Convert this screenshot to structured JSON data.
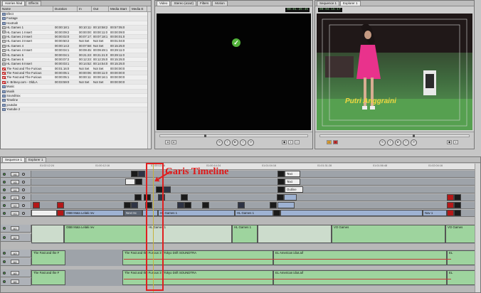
{
  "browser": {
    "tabs": [
      "Harries hlad",
      "Effects"
    ],
    "columns": [
      "Name",
      "Duration",
      "In",
      "Out",
      "Media Start",
      "Media E"
    ],
    "rows": [
      {
        "kind": "folder",
        "name": "Efect"
      },
      {
        "kind": "folder",
        "name": "Footage"
      },
      {
        "kind": "folder",
        "name": "Hootnah"
      },
      {
        "kind": "seq",
        "name": "HL Games 1",
        "duration": "00:00:18:1",
        "in": "00:10:11:0",
        "out": "00:10:58:2",
        "ms": "00:57:05:0"
      },
      {
        "kind": "seq",
        "name": "HL Games 1 Insert",
        "duration": "00:00:09:2",
        "in": "00:00:00:0",
        "out": "00:00:11:0",
        "ms": "00:00:09:0"
      },
      {
        "kind": "seq",
        "name": "HL Games 2 Insert",
        "duration": "00:00:02:0",
        "in": "00:07:17:0",
        "out": "00:07:18:1",
        "ms": "00:00:01:0"
      },
      {
        "kind": "seq",
        "name": "HL Games 3 Insert",
        "duration": "00:00:50:2",
        "in": "Not Set",
        "out": "Not Set",
        "ms": "00:01:04:0"
      },
      {
        "kind": "seq",
        "name": "HL Games 4",
        "duration": "00:00:14:2",
        "in": "00:07:58:1",
        "out": "Not Set",
        "ms": "00:15:25:0"
      },
      {
        "kind": "seq",
        "name": "HL Games 4 Insert",
        "duration": "00:00:04:1",
        "in": "00:09:45:2",
        "out": "00:09:49:1",
        "ms": "00:29:11:0"
      },
      {
        "kind": "seq",
        "name": "HL Games 5",
        "duration": "00:00:04:1",
        "in": "00:21:23:1",
        "out": "00:21:21:0",
        "ms": "00:29:11:0"
      },
      {
        "kind": "seq",
        "name": "HL Games 6",
        "duration": "00:00:07:2",
        "in": "00:12:23:0",
        "out": "00:12:25:0",
        "ms": "00:15:25:0"
      },
      {
        "kind": "seq",
        "name": "HL Games 6 Insert",
        "duration": "00:00:03:1",
        "in": "00:14:52:1",
        "out": "00:14:54:0",
        "ms": "00:15:25:0"
      },
      {
        "kind": "red",
        "name": "The Fast and The Furious",
        "duration": "00:01:16:0",
        "in": "Not Set",
        "out": "Not Set",
        "ms": "00:00:00:0"
      },
      {
        "kind": "red",
        "name": "The Fast and The Furious",
        "duration": "00:00:05:1",
        "in": "00:00:06:2",
        "out": "00:00:11:0",
        "ms": "00:00:00:0"
      },
      {
        "kind": "red",
        "name": "The Fast and The Furious",
        "duration": "00:00:05:1",
        "in": "00:00:11:1",
        "out": "00:00:16:1",
        "ms": "00:00:00:0"
      },
      {
        "kind": "red",
        "name": "X- Britney.com - OldLA",
        "duration": "00:03:59:0",
        "in": "Not Set",
        "out": "Not Set",
        "ms": "00:00:00:0"
      },
      {
        "kind": "folder",
        "name": "Music"
      },
      {
        "kind": "folder",
        "name": "Musik"
      },
      {
        "kind": "folder",
        "name": "Soundtrax"
      },
      {
        "kind": "folder",
        "name": "Timeline"
      },
      {
        "kind": "folder",
        "name": "youtube"
      },
      {
        "kind": "folder",
        "name": "Youtube 2"
      }
    ]
  },
  "viewer": {
    "tabs": [
      "Video",
      "Stereo (a1a2)",
      "Filters",
      "Motion"
    ],
    "timecode": "00:01:26:45"
  },
  "canvas": {
    "tabs": [
      "Sequence 1",
      "Explorer 1"
    ],
    "timecode": "00:04:15:17",
    "overlay_name": "Putri Anggraini"
  },
  "timeline": {
    "tabs": [
      "Sequence 1",
      "Explorer 1"
    ],
    "ruler": [
      "01:02:12:24",
      "01:00:12:16",
      "01:00:13:16",
      "01:00:14:24",
      "01:01:04:16",
      "01:01:31:28",
      "01:01:56:48",
      "01:02:04:16"
    ],
    "video_tracks": [
      {
        "label": "V6"
      },
      {
        "label": "V5"
      },
      {
        "label": "V4"
      },
      {
        "label": "V3"
      },
      {
        "label": "V2"
      },
      {
        "label": "V1"
      }
    ],
    "audio_tracks": [
      {
        "label": "A1"
      },
      {
        "label": "A2"
      },
      {
        "label": "A3"
      },
      {
        "label": "A4"
      },
      {
        "label": "A5"
      },
      {
        "label": "A6"
      }
    ],
    "clips": {
      "text1": "Text",
      "text2": "Text",
      "outline": "Outline",
      "obb": "OBB Mata Lelaki rev",
      "next": "Next Sc",
      "hlg1": "HL Games 1",
      "hlg1b": "HL Games 1",
      "nav": "Nav 1",
      "a_obb": "OBB Mata Lelaki rev",
      "a_hl": "HL Games 1",
      "a_hl2": "HL Games 1",
      "a_vo": "VO Games",
      "a_vo2": "VO Games",
      "ff1": "The Fast and the F",
      "ff2": "The Fast and the Furious 3 - Tokyo Drift SOUNDTRA",
      "el1": "EL American idiot.aif",
      "el2": "EL",
      "ff3": "The Fast and the F",
      "ff4": "The Fast and the Furious 3 - Tokyo Drift SOUNDTRA",
      "el3": "EL American idiot.aif",
      "el4": "EL"
    }
  },
  "annotation": "Garis Timeline"
}
